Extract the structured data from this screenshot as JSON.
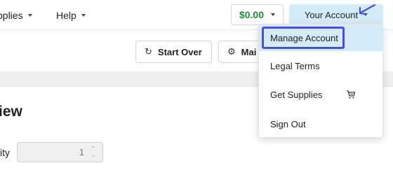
{
  "nav": {
    "items": [
      {
        "label": "pplies"
      },
      {
        "label": "Help"
      }
    ],
    "balance": "$0.00",
    "account_label": "Your Account"
  },
  "toolbar": {
    "start_over_label": "Start Over",
    "second_label": "Mai"
  },
  "main": {
    "heading": "iew",
    "quantity_label": "ity",
    "quantity_value": "1"
  },
  "account_menu": {
    "items": [
      {
        "label": "Manage Account",
        "active": true
      },
      {
        "label": "Legal Terms"
      },
      {
        "label": "Get Supplies",
        "icon": "cart-icon"
      },
      {
        "label": "Sign Out"
      }
    ]
  },
  "colors": {
    "accent_bg": "#d3ecf7",
    "highlight": "#4b4ee0",
    "balance": "#1e8a3a"
  }
}
